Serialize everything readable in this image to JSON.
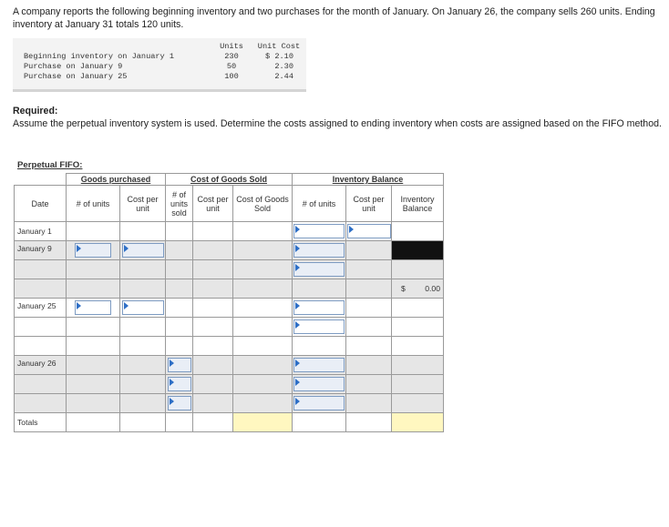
{
  "intro": "A company reports the following beginning inventory and two purchases for the month of January. On January 26, the company sells 260 units. Ending inventory at January 31 totals 120 units.",
  "inventory_data": {
    "headers": {
      "units": "Units",
      "unit_cost": "Unit Cost"
    },
    "rows": [
      {
        "label": "Beginning inventory on January 1",
        "units": "230",
        "cost": "$ 2.10"
      },
      {
        "label": "Purchase on January 9",
        "units": "50",
        "cost": "2.30"
      },
      {
        "label": "Purchase on January 25",
        "units": "100",
        "cost": "2.44"
      }
    ]
  },
  "required": {
    "heading": "Required:",
    "text": "Assume the perpetual inventory system is used. Determine the costs assigned to ending inventory when costs are assigned based on the FIFO method."
  },
  "fifo": {
    "title": "Perpetual FIFO:",
    "groups": {
      "purchased": "Goods purchased",
      "cogs": "Cost of Goods Sold",
      "balance": "Inventory Balance"
    },
    "columns": {
      "date": "Date",
      "p_units": "# of units",
      "p_cost": "Cost per unit",
      "s_units": "# of units sold",
      "s_cost": "Cost per unit",
      "s_total": "Cost of Goods Sold",
      "b_units": "# of units",
      "b_cost": "Cost per unit",
      "b_total": "Inventory Balance"
    },
    "dates": {
      "jan1": "January 1",
      "jan9": "January 9",
      "jan25": "January 25",
      "jan26": "January 26",
      "totals": "Totals"
    },
    "jan9_balance": {
      "symbol": "$",
      "value": "0.00"
    }
  }
}
